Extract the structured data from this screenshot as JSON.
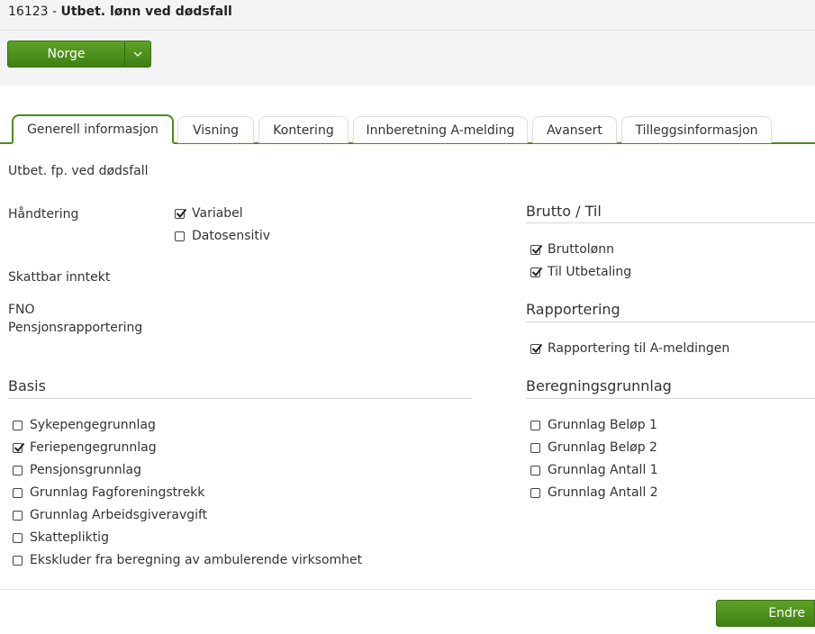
{
  "header": {
    "code": "16123",
    "separator": " - ",
    "title": "Utbet. lønn ved dødsfall"
  },
  "toolbar": {
    "country_button": "Norge",
    "caret_icon": "chevron-down-icon"
  },
  "tabs": [
    {
      "label": "Generell informasjon",
      "active": true
    },
    {
      "label": "Visning"
    },
    {
      "label": "Kontering"
    },
    {
      "label": "Innberetning A-melding"
    },
    {
      "label": "Avansert"
    },
    {
      "label": "Tilleggsinformasjon"
    }
  ],
  "general": {
    "description": "Utbet. fp. ved dødsfall",
    "handtering_label": "Håndtering",
    "handtering_options": [
      {
        "label": "Variabel",
        "checked": true
      },
      {
        "label": "Datosensitiv",
        "checked": false
      }
    ],
    "skattbar_label": "Skattbar inntekt",
    "fno_label": "FNO",
    "pensjon_label": "Pensjonsrapportering"
  },
  "brutto": {
    "title": "Brutto / Til",
    "items": [
      {
        "label": "Bruttolønn",
        "checked": true
      },
      {
        "label": "Til Utbetaling",
        "checked": true
      }
    ]
  },
  "rapportering": {
    "title": "Rapportering",
    "items": [
      {
        "label": "Rapportering til A-meldingen",
        "checked": true
      }
    ]
  },
  "basis": {
    "title": "Basis",
    "items": [
      {
        "label": "Sykepengegrunnlag",
        "checked": false
      },
      {
        "label": "Feriepengegrunnlag",
        "checked": true
      },
      {
        "label": "Pensjonsgrunnlag",
        "checked": false
      },
      {
        "label": "Grunnlag Fagforeningstrekk",
        "checked": false
      },
      {
        "label": "Grunnlag Arbeidsgiveravgift",
        "checked": false
      },
      {
        "label": "Skattepliktig",
        "checked": false
      },
      {
        "label": "Ekskluder fra beregning av ambulerende virksomhet",
        "checked": false
      }
    ]
  },
  "beregning": {
    "title": "Beregningsgrunnlag",
    "items": [
      {
        "label": "Grunnlag Beløp 1",
        "checked": false
      },
      {
        "label": "Grunnlag Beløp 2",
        "checked": false
      },
      {
        "label": "Grunnlag Antall 1",
        "checked": false
      },
      {
        "label": "Grunnlag Antall 2",
        "checked": false
      }
    ]
  },
  "footer": {
    "edit_button": "Endre"
  },
  "colors": {
    "accent": "#4a8b1c",
    "button_top": "#5fa227",
    "button_bottom": "#3f7f13"
  }
}
